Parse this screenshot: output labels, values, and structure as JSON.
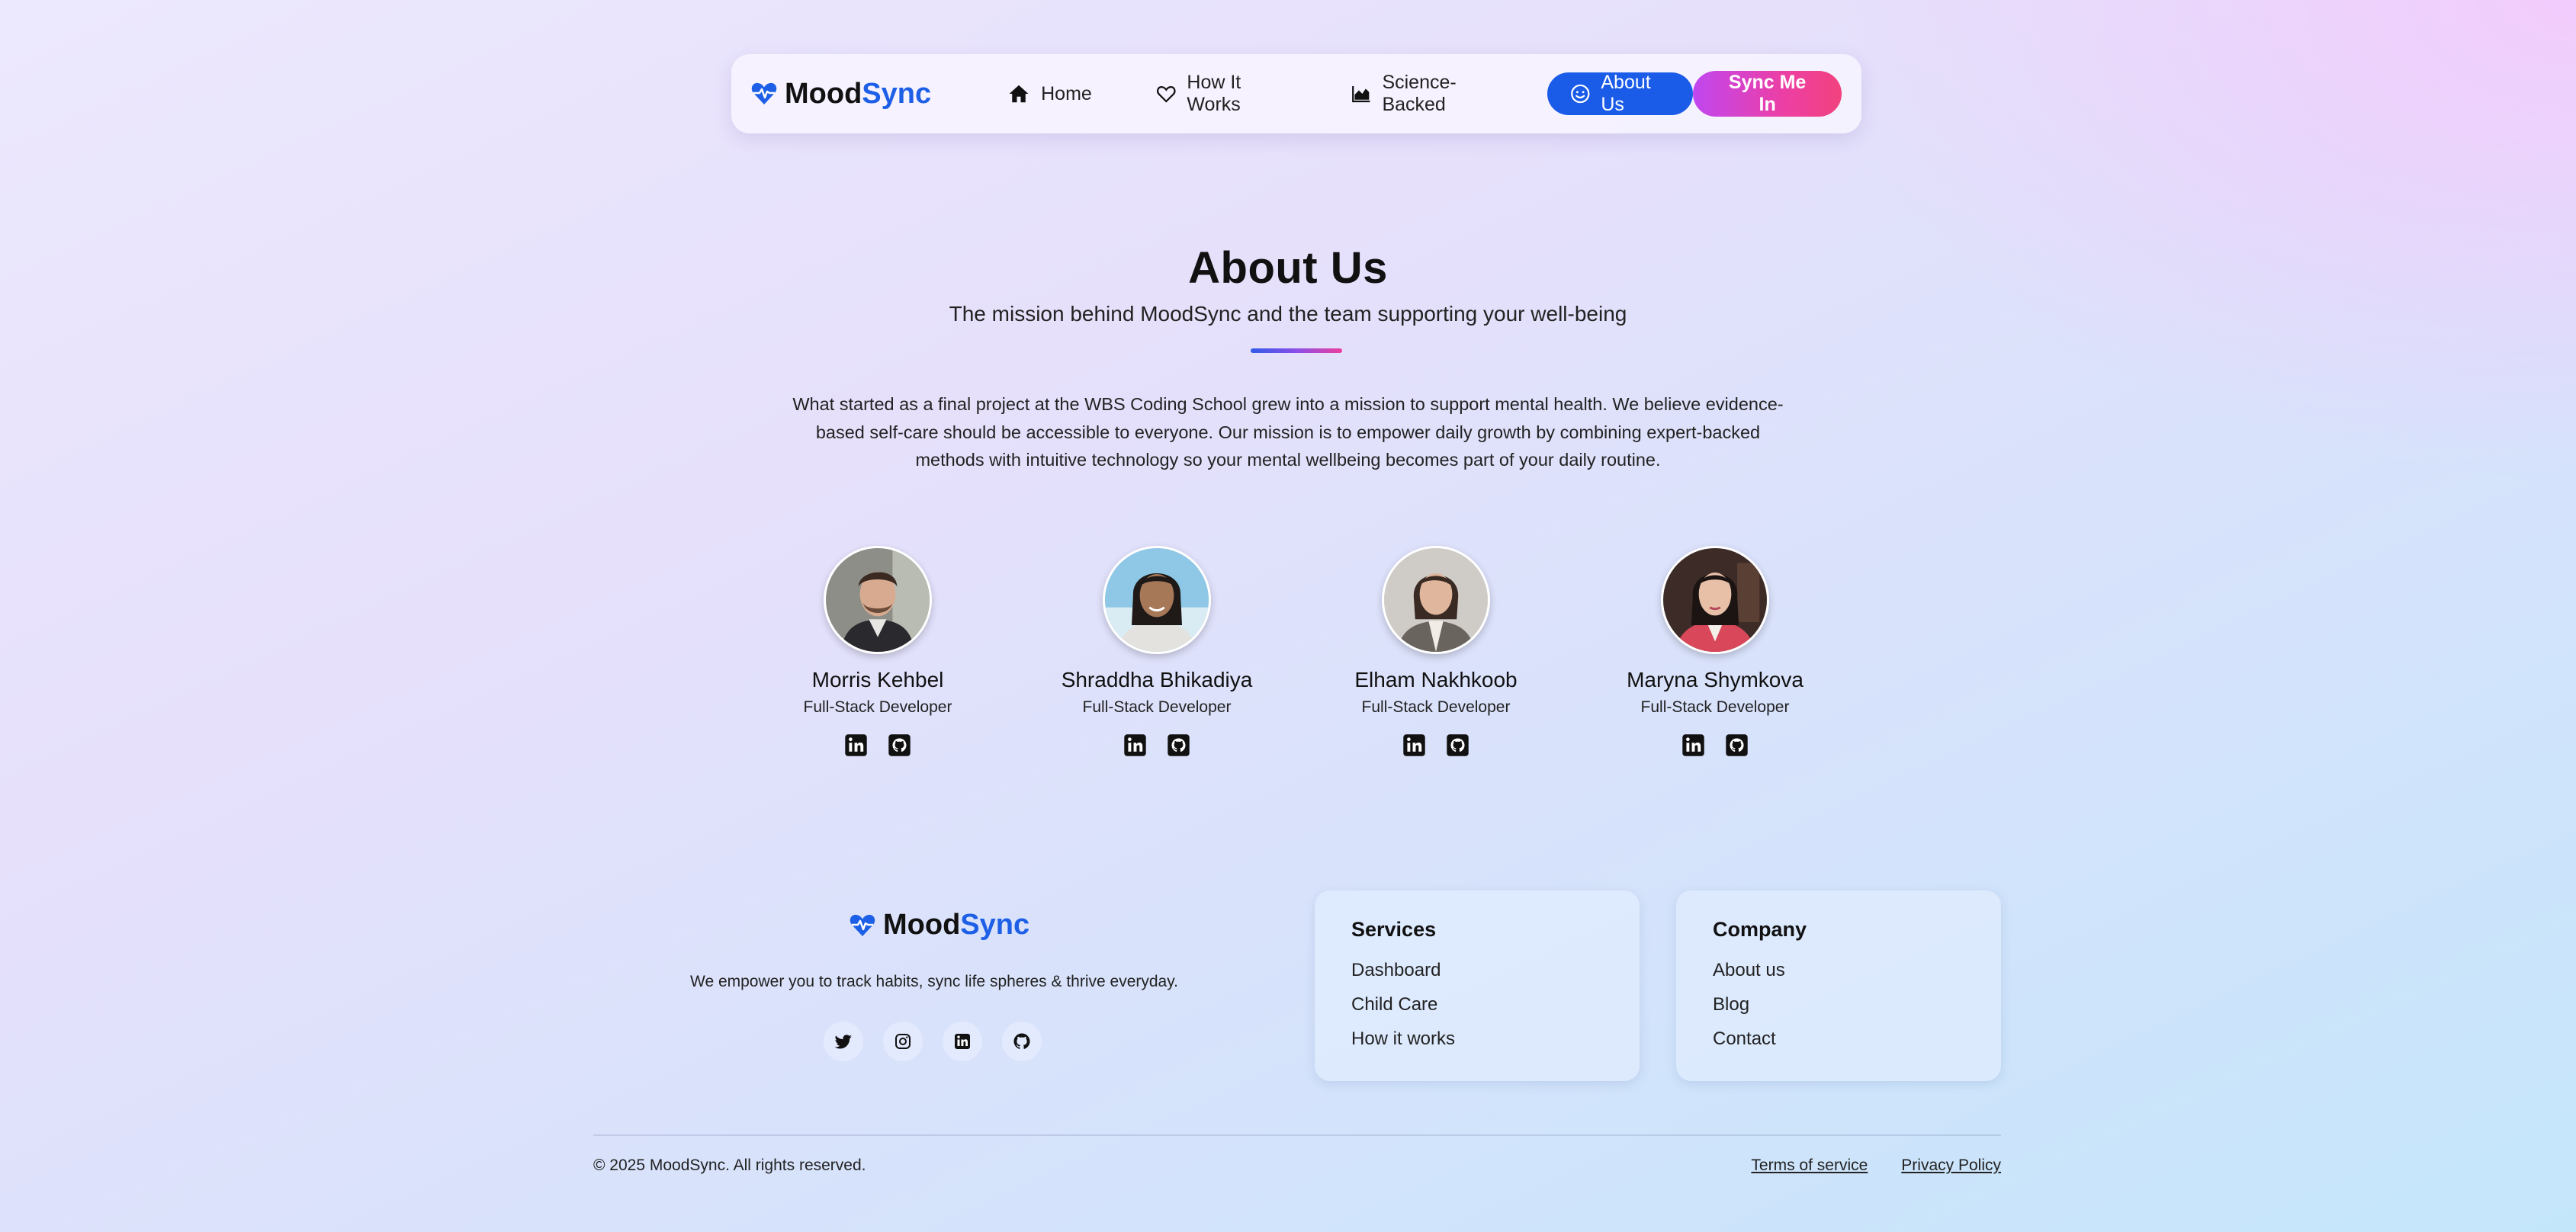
{
  "brand": {
    "name_part1": "Mood",
    "name_part2": "Sync",
    "color": "#1d5fe6"
  },
  "nav": {
    "items": [
      {
        "label": "Home",
        "icon": "home-icon"
      },
      {
        "label": "How It Works",
        "icon": "heart-icon"
      },
      {
        "label": "Science-Backed",
        "icon": "chart-area-icon"
      },
      {
        "label": "About Us",
        "icon": "smile-icon",
        "active": true
      }
    ],
    "cta_label": "Sync Me In"
  },
  "hero": {
    "title": "About Us",
    "subtitle": "The mission behind MoodSync and the team supporting your well-being",
    "mission": "What started as a final project at the WBS Coding School grew into a mission to support mental health. We believe evidence-based self-care should be accessible to everyone. Our mission is to empower daily growth by combining expert-backed methods with intuitive technology so your mental wellbeing becomes part of your daily routine."
  },
  "team": [
    {
      "name": "Morris Kehbel",
      "role": "Full-Stack Developer"
    },
    {
      "name": "Shraddha Bhikadiya",
      "role": "Full-Stack Developer"
    },
    {
      "name": "Elham Nakhkoob",
      "role": "Full-Stack Developer"
    },
    {
      "name": "Maryna Shymkova",
      "role": "Full-Stack Developer"
    }
  ],
  "footer": {
    "tagline": "We empower you to track habits, sync life spheres & thrive everyday.",
    "socials": [
      "twitter-icon",
      "instagram-icon",
      "linkedin-icon",
      "github-icon"
    ],
    "services": {
      "title": "Services",
      "links": [
        "Dashboard",
        "Child Care",
        "How it works"
      ]
    },
    "company": {
      "title": "Company",
      "links": [
        "About us",
        "Blog",
        "Contact"
      ]
    },
    "copyright": "© 2025 MoodSync. All rights reserved.",
    "legal": [
      "Terms of service",
      "Privacy Policy"
    ]
  },
  "colors": {
    "accent": "#1a5be8",
    "cta_start": "#c047f0",
    "cta_end": "#f2427e"
  }
}
